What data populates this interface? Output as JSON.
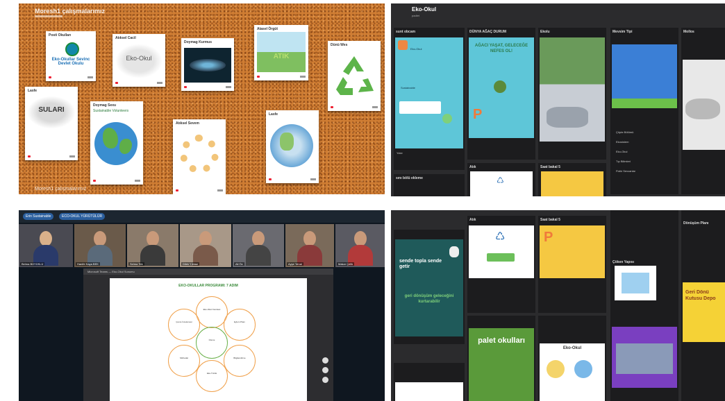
{
  "panel1": {
    "title": "Moresh1 çalışmalarımız",
    "footer": "Moresh1 çalışmalarımız",
    "notes": [
      {
        "title": "Posti Okulları",
        "text": "Eko-Okullar Sevinc Devlet Okulu"
      },
      {
        "title": "Atıksel Cacil",
        "text": "Eko-Okul"
      },
      {
        "title": "Doymag Kurmus",
        "text": ""
      },
      {
        "title": "Atasel Örgüt",
        "text": "ATIK"
      },
      {
        "title": "Dünü Wes",
        "text": ""
      },
      {
        "title": "Lasfe",
        "text": "SULARI"
      },
      {
        "title": "Doymag Sexu",
        "text": "Sustainable Volunteers"
      },
      {
        "title": "Atıksel Sevem",
        "text": ""
      },
      {
        "title": "Lasfe",
        "text": ""
      }
    ]
  },
  "panel2": {
    "title": "Eko-Okul",
    "subtitle": "padlet",
    "columns": [
      {
        "header": "sunt obcam",
        "lines": [
          "Eko-Okul",
          "Sustainable",
          "Yoke"
        ]
      },
      {
        "header": "DÜNYA AĞAÇ DURUM",
        "poster": "AĞACI YAŞAT, GELECEĞE NEFES OL!"
      },
      {
        "header": "Ekolu",
        "poster": ""
      },
      {
        "header": "Mevsim Tipi",
        "items": [
          "Çöpte Bölümü",
          "Ekosistem",
          "Eko-Okul",
          "Tıp Bilimleri",
          "Fiziki Sevcanlar"
        ]
      },
      {
        "header": "Mollos",
        "items": []
      }
    ],
    "lower": [
      {
        "header": "Saat bakal 5"
      },
      {
        "header": "Atık"
      }
    ],
    "bottom_header": "sını bölü ekleme"
  },
  "panel3": {
    "chip1": "Erin Sustainable",
    "chip2": "ECO-OKUL YÜRÜTÜLÜR",
    "participants": [
      "Belma BÜYÜKLÜ",
      "Hanife Kaya BEK",
      "Selma Tek",
      "Dilek Yılmaz",
      "Ali Öz",
      "Ayşe Yenal",
      "Makar Çelik"
    ],
    "window_title": "Microsoft Teams — Eko-Okul Sunumu",
    "doc_title": "EKO-OKULLAR PROGRAMI: 7 ADIM",
    "steps": [
      "Eko-Okul Komitesi",
      "Çevre İncelemesi",
      "Eylem Planı",
      "İzleme",
      "Müfredat",
      "Bilgilendirme",
      "Eko-Tüzük"
    ]
  },
  "panel4": {
    "poster1": "sende topla sende getir",
    "poster1b": "geri dönüşüm geleceğini kurtarabilir",
    "card_header": "Atık",
    "card2_header": "Saat bakal 5",
    "poster2": "palet okulları",
    "card3_header": "Eko-Okul",
    "right_title": "Çöken Yapısı",
    "right_poster": "Geri Dönü Kutusu Depo",
    "plan_header": "Dönüşüm Planı"
  }
}
